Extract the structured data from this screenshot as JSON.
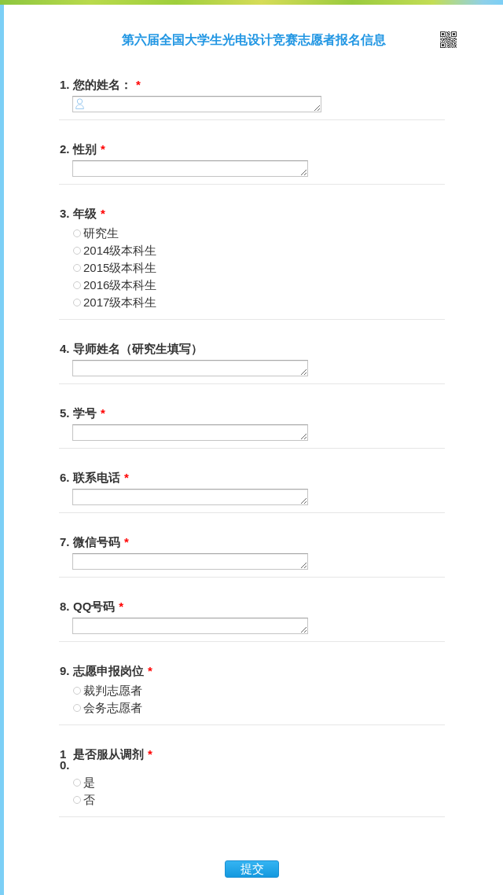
{
  "header": {
    "title": "第六届全国大学生光电设计竞赛志愿者报名信息"
  },
  "questions": [
    {
      "kind": "name",
      "number": "1.",
      "title": "您的姓名：",
      "asterisk": "*"
    },
    {
      "kind": "text",
      "number": "2.",
      "title": "性别",
      "asterisk": "*"
    },
    {
      "kind": "choice",
      "number": "3.",
      "title": "年级",
      "asterisk": "*",
      "options": [
        {
          "label": "研究生",
          "selected": false
        },
        {
          "label": "2014级本科生",
          "selected": false
        },
        {
          "label": "2015级本科生",
          "selected": false
        },
        {
          "label": "2016级本科生",
          "selected": false
        },
        {
          "label": "2017级本科生",
          "selected": false
        }
      ]
    },
    {
      "kind": "text",
      "number": "4.",
      "title": "导师姓名（研究生填写）"
    },
    {
      "kind": "text",
      "number": "5.",
      "title": "学号",
      "asterisk": "*"
    },
    {
      "kind": "text",
      "number": "6.",
      "title": "联系电话",
      "asterisk": "*"
    },
    {
      "kind": "text",
      "number": "7.",
      "title": "微信号码",
      "asterisk": "*"
    },
    {
      "kind": "text",
      "number": "8.",
      "title": "QQ号码",
      "asterisk": "*"
    },
    {
      "kind": "choice",
      "number": "9.",
      "title": "志愿申报岗位",
      "asterisk": "*",
      "options": [
        {
          "label": "裁判志愿者",
          "selected": false
        },
        {
          "label": "会务志愿者",
          "selected": false
        }
      ]
    },
    {
      "kind": "choice",
      "number": "10.",
      "title": "是否服从调剂",
      "asterisk": "*",
      "options": [
        {
          "label": "是",
          "selected": false
        },
        {
          "label": "否",
          "selected": false
        }
      ]
    }
  ],
  "submit_button": "提交"
}
